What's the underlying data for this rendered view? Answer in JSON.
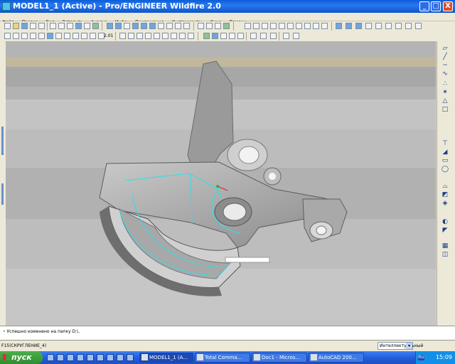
{
  "window": {
    "title": "MODEL1_1 (Active) - Pro/ENGINEER Wildfire 2.0",
    "controls": {
      "minimize": "_",
      "maximize": "□",
      "close": "X"
    }
  },
  "menu": {
    "items": [
      "Файл",
      "Правка",
      "Вид",
      "Вставить",
      "Анализ",
      "Инфо",
      "Приложения",
      "Инструменты",
      "Окно",
      "Помощь"
    ]
  },
  "toolbar": {
    "zoom_label": "2.01"
  },
  "message": {
    "bullet": "•",
    "text": "Успешно изменено на папку D:\\."
  },
  "status": {
    "feature": "F15(СКРУГЛЕНИЕ_4)",
    "filter_value": "Интеллектуальный",
    "filter_arrow": "▾"
  },
  "taskbar": {
    "start_label": "пуск",
    "tasks": [
      "MODEL1_1 (A...",
      "Total Comma...",
      "Doc1 - Micros...",
      "AutoCAD 200..."
    ],
    "tray_lang": "RU",
    "clock": "15:09"
  },
  "colors": {
    "title_bar": "#2a78f0",
    "viewport_bands": [
      "#b4b4b4",
      "#a7a7a7",
      "#c0b79c",
      "#bfbfbf",
      "#b9b9b9",
      "#adadad",
      "#b2b2b2",
      "#c6c6c6"
    ],
    "model_edges": "#2ae0ee"
  },
  "icons": {
    "right_toolbar": [
      "datum-plane-icon",
      "datum-axis-icon",
      "sketch-icon",
      "curve-icon",
      "point-icon",
      "coordsys-icon",
      "analysis-icon",
      "extrude-icon",
      "revolve-icon",
      "sweep-icon",
      "blend-icon",
      "hole-icon",
      "shell-icon",
      "rib-icon",
      "draft-icon",
      "round-icon",
      "chamfer-icon",
      "pattern-icon",
      "mirror-icon"
    ]
  }
}
